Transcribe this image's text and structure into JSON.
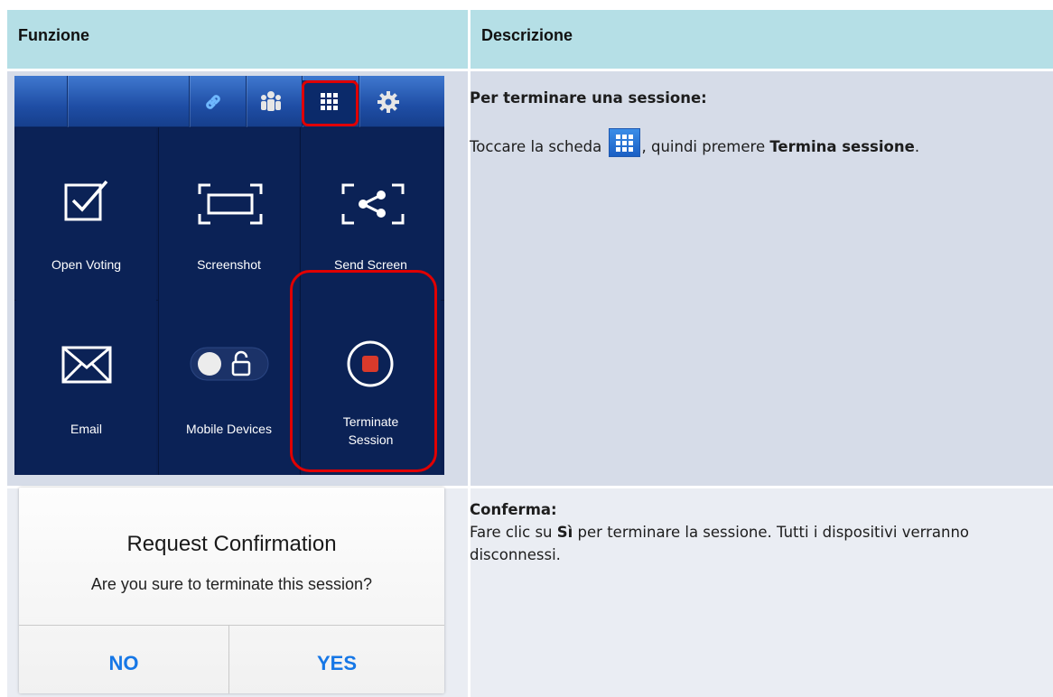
{
  "table": {
    "header_function": "Funzione",
    "header_description": "Descrizione"
  },
  "row1": {
    "menu": {
      "items": [
        {
          "label": "Open Voting",
          "icon": "checkbox-icon"
        },
        {
          "label": "Screenshot",
          "icon": "screenshot-frame-icon"
        },
        {
          "label": "Send Screen",
          "icon": "share-screen-icon"
        },
        {
          "label": "Email",
          "icon": "envelope-icon"
        },
        {
          "label": "Mobile Devices",
          "icon": "lock-toggle-icon"
        },
        {
          "label_line1": "Terminate",
          "label_line2": "Session",
          "icon": "stop-icon"
        }
      ],
      "toolbar_icons": [
        "link-icon",
        "participants-icon",
        "grid-icon",
        "gear-icon"
      ]
    },
    "title": "Per terminare una sessione:",
    "text_before": "Toccare la scheda",
    "text_middle": ", quindi premere ",
    "text_bold": "Termina sessione",
    "text_end": "."
  },
  "row2": {
    "dialog": {
      "title": "Request Confirmation",
      "message": "Are you sure to terminate this session?",
      "no_label": "NO",
      "yes_label": "YES"
    },
    "title": "Conferma:",
    "text_before": "Fare clic su ",
    "text_bold": "Sì",
    "text_after": " per terminare la sessione. Tutti i dispositivi verranno disconnessi."
  },
  "colors": {
    "header_bg": "#b5dfe6",
    "row1_bg": "#d6dce8",
    "row2_bg": "#eaedf3",
    "highlight": "#e00000",
    "dialog_button": "#1677e6"
  }
}
